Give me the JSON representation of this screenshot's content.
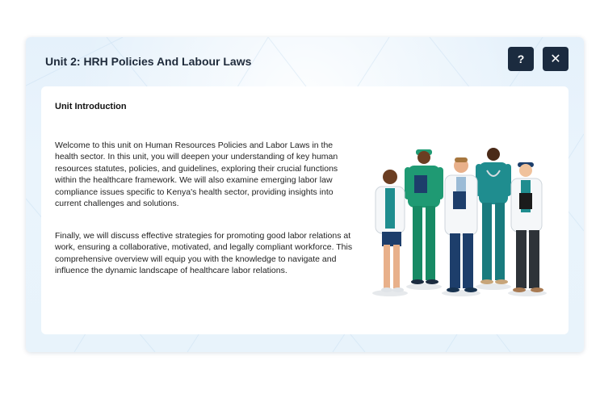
{
  "header": {
    "title": "Unit 2: HRH Policies And Labour Laws",
    "help_label": "?",
    "close_label": "✕"
  },
  "content": {
    "heading": "Unit Introduction",
    "paragraph1": "Welcome to this unit on Human Resources Policies and Labor Laws in the health sector. In this unit, you will deepen your understanding of key human resources statutes, policies, and guidelines, exploring their crucial functions within the healthcare framework. We will also examine emerging labor law compliance issues specific to Kenya's health sector, providing insights into current challenges and solutions.",
    "paragraph2": "Finally, we will discuss effective strategies for promoting good labor relations at work, ensuring a collaborative, motivated, and legally compliant workforce. This comprehensive overview will equip you with the knowledge to navigate and influence the dynamic landscape of healthcare labor relations."
  },
  "colors": {
    "header_button_bg": "#1b2b3f",
    "modal_bg": "#e8f3fb",
    "scrubs_green": "#1f9a73",
    "scrubs_teal": "#1f8d8f",
    "navy": "#1d3e6b"
  },
  "icons": [
    "help-icon",
    "close-icon",
    "healthcare-workers-illustration"
  ]
}
